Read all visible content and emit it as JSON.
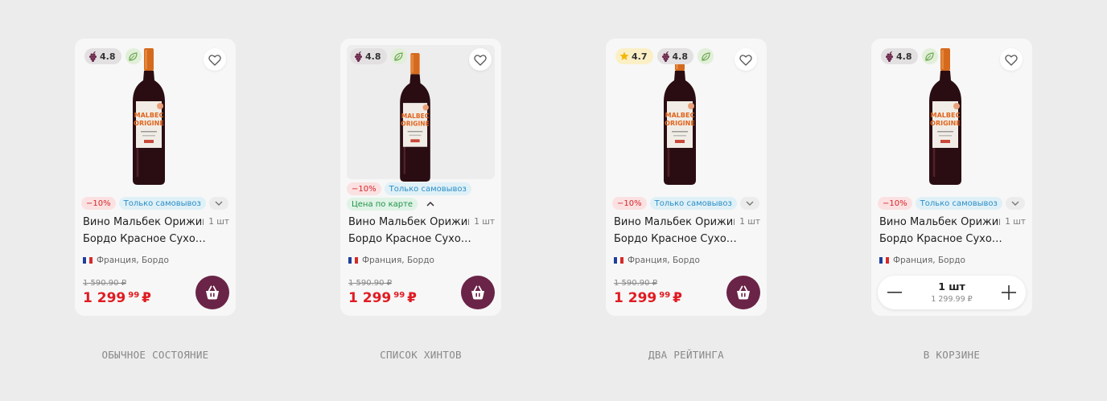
{
  "colors": {
    "background": "#ececec",
    "card": "#f7f7f7",
    "price_red": "#e11b22",
    "cart_button": "#6a2447"
  },
  "cards": [
    {
      "state_caption": "ОБЫЧНОЕ СОСТОЯНИЕ",
      "ratings": [
        {
          "icon": "grape-icon",
          "value": "4.8"
        }
      ],
      "eco_icon": "leaf-icon",
      "tags": {
        "discount": "−10%",
        "pickup": "Только самовывоз"
      },
      "title_line1": "Вино Мальбек Орижин",
      "title_line2": "Бордо Красное Сухо…",
      "quantity": "1 шт",
      "origin": "Франция, Бордо",
      "old_price": "1 590.90 ₽",
      "price_main": "1 299",
      "price_cents": "99",
      "currency": "₽"
    },
    {
      "state_caption": "СПИСОК ХИНТОВ",
      "ratings": [
        {
          "icon": "grape-icon",
          "value": "4.8"
        }
      ],
      "eco_icon": "leaf-icon",
      "tags": {
        "discount": "−10%",
        "pickup": "Только самовывоз",
        "card_price": "Цена по карте"
      },
      "title_line1": "Вино Мальбек Орижин",
      "title_line2": "Бордо Красное Сухо…",
      "quantity": "1 шт",
      "origin": "Франция, Бордо",
      "old_price": "1 590.90 ₽",
      "price_main": "1 299",
      "price_cents": "99",
      "currency": "₽"
    },
    {
      "state_caption": "ДВА РЕЙТИНГА",
      "ratings": [
        {
          "icon": "star-icon",
          "value": "4.7"
        },
        {
          "icon": "grape-icon",
          "value": "4.8"
        }
      ],
      "eco_icon": "leaf-icon",
      "tags": {
        "discount": "−10%",
        "pickup": "Только самовывоз"
      },
      "title_line1": "Вино Мальбек Орижин",
      "title_line2": "Бордо Красное Сухо…",
      "quantity": "1 шт",
      "origin": "Франция, Бордо",
      "old_price": "1 590.90 ₽",
      "price_main": "1 299",
      "price_cents": "99",
      "currency": "₽"
    },
    {
      "state_caption": "В КОРЗИНЕ",
      "ratings": [
        {
          "icon": "grape-icon",
          "value": "4.8"
        }
      ],
      "eco_icon": "leaf-icon",
      "tags": {
        "discount": "−10%",
        "pickup": "Только самовывоз"
      },
      "title_line1": "Вино Мальбек Орижин",
      "title_line2": "Бордо Красное Сухо…",
      "quantity": "1 шт",
      "origin": "Франция, Бордо",
      "stepper_count": "1 шт",
      "stepper_sum": "1 299.99 ₽"
    }
  ]
}
